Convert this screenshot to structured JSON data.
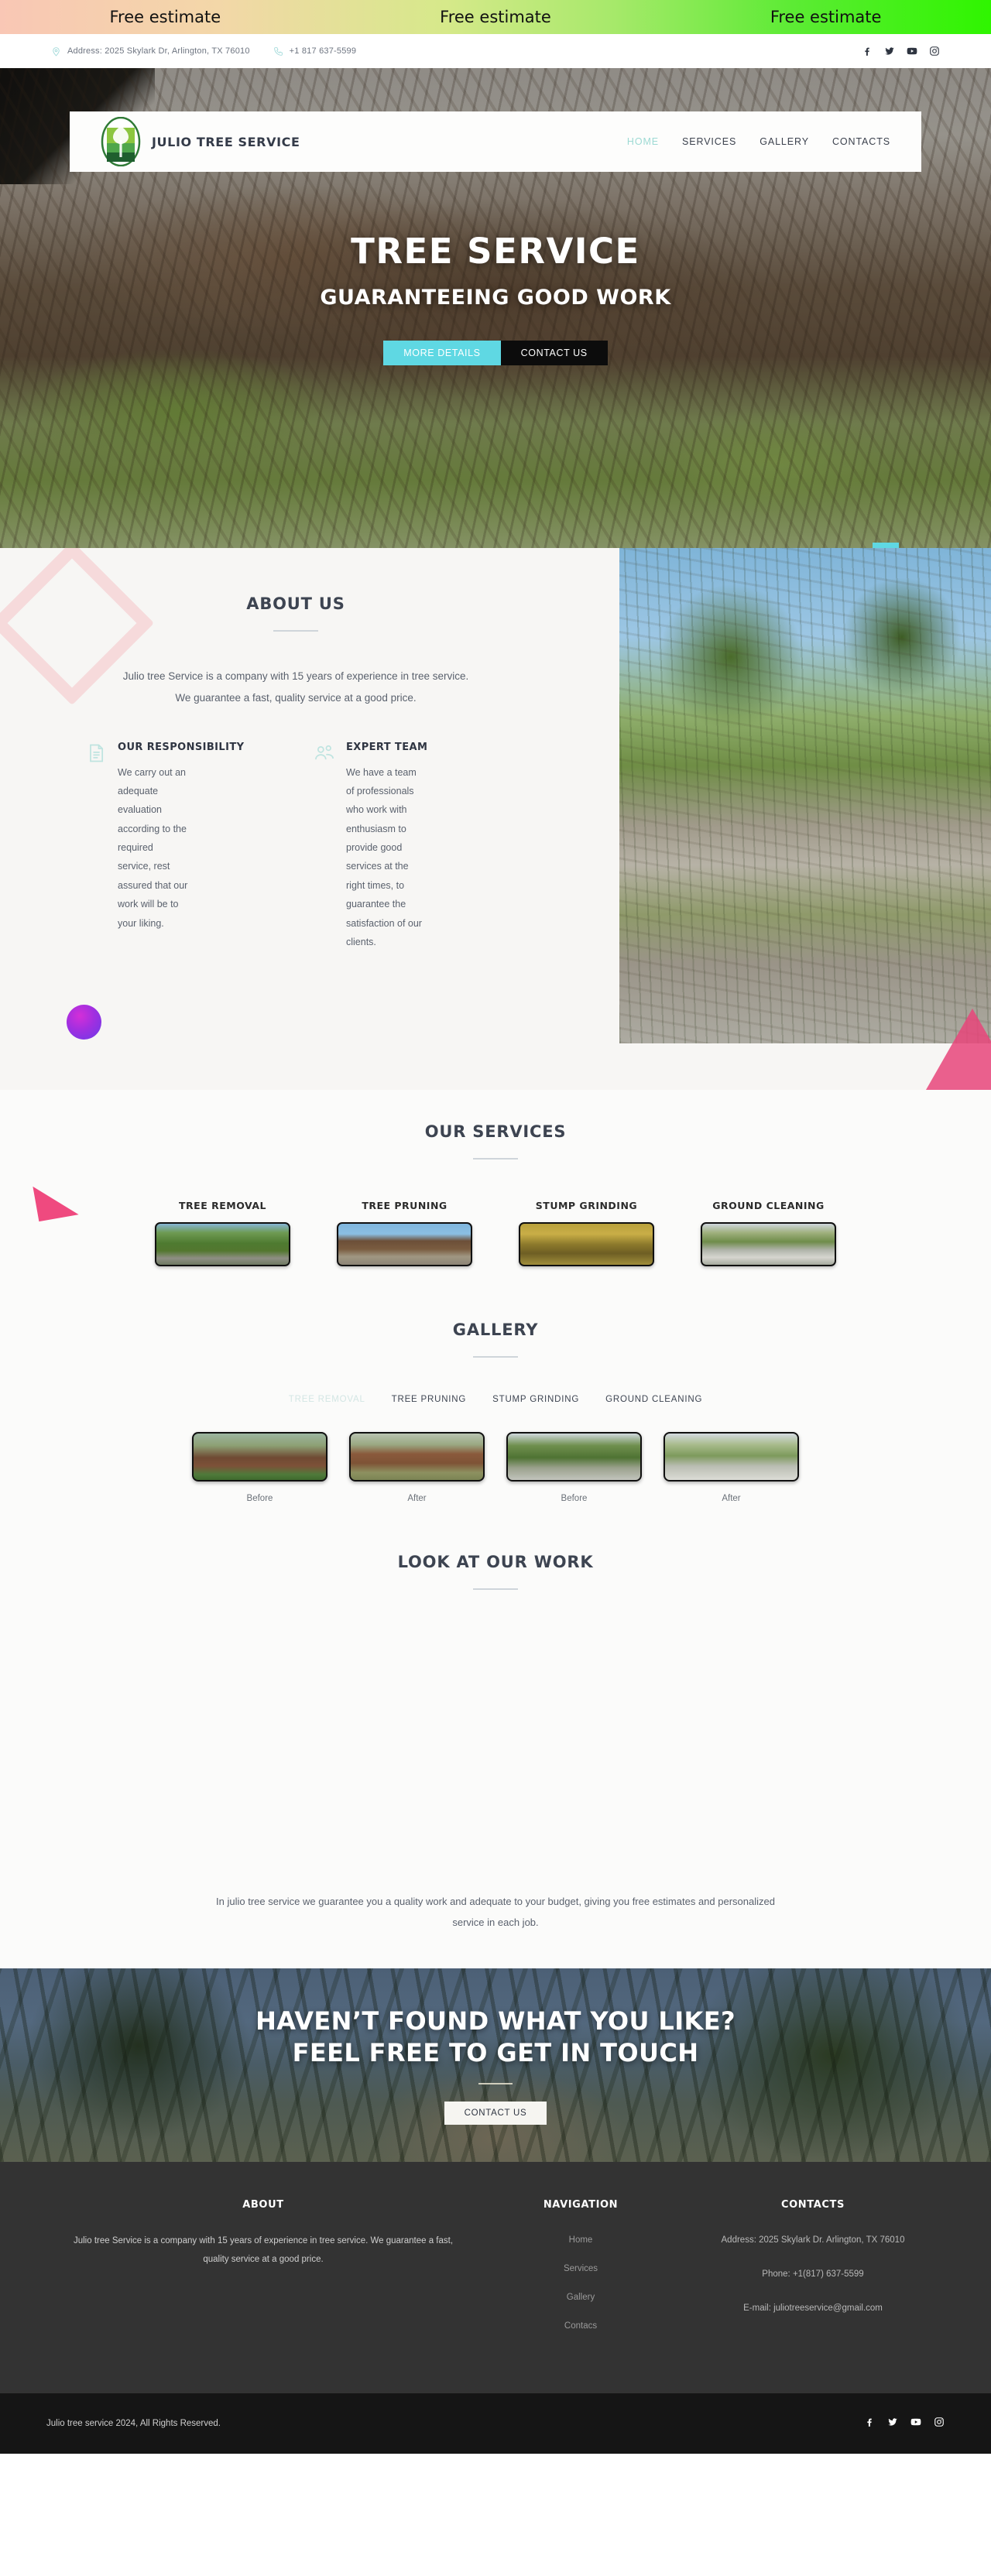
{
  "promo": {
    "items": [
      "Free estimate",
      "Free estimate",
      "Free estimate"
    ]
  },
  "topbar": {
    "address": "Address: 2025 Skylark Dr, Arlington, TX 76010",
    "phone": "+1 817 637-5599",
    "socials": [
      "facebook-icon",
      "twitter-icon",
      "youtube-icon",
      "instagram-icon"
    ]
  },
  "nav": {
    "brand": "JULIO TREE SERVICE",
    "links": [
      {
        "label": "HOME",
        "active": true
      },
      {
        "label": "SERVICES",
        "active": false
      },
      {
        "label": "GALLERY",
        "active": false
      },
      {
        "label": "CONTACTS",
        "active": false
      }
    ]
  },
  "hero": {
    "title": "TREE SERVICE",
    "subtitle": "GUARANTEEING GOOD WORK",
    "btn_primary": "MORE DETAILS",
    "btn_secondary": "CONTACT US",
    "accent_color": "#5fd8e3"
  },
  "about": {
    "title": "ABOUT US",
    "paragraph": "Julio tree Service is a company with 15 years of experience in tree service. We guarantee a fast, quality service at a good price.",
    "features": [
      {
        "icon": "document-icon",
        "title": "OUR RESPONSIBILITY",
        "text": "We carry out an adequate evaluation according to the required service, rest assured that our work will be to your liking."
      },
      {
        "icon": "team-icon",
        "title": "EXPERT TEAM",
        "text": "We have a team of professionals who work with enthusiasm to provide good services at the right times, to guarantee the satisfaction of our clients."
      }
    ]
  },
  "services": {
    "title": "OUR SERVICES",
    "items": [
      {
        "label": "TREE REMOVAL"
      },
      {
        "label": "TREE PRUNING"
      },
      {
        "label": "STUMP GRINDING"
      },
      {
        "label": "GROUND CLEANING"
      }
    ]
  },
  "gallery": {
    "title": "GALLERY",
    "tabs": [
      {
        "label": "TREE REMOVAL",
        "active": true
      },
      {
        "label": "TREE PRUNING",
        "active": false
      },
      {
        "label": "STUMP GRINDING",
        "active": false
      },
      {
        "label": "GROUND CLEANING",
        "active": false
      }
    ],
    "items": [
      {
        "caption": "Before"
      },
      {
        "caption": "After"
      },
      {
        "caption": "Before"
      },
      {
        "caption": "After"
      }
    ]
  },
  "work": {
    "title": "LOOK AT OUR WORK",
    "paragraph": "In julio tree service we guarantee you a quality work and adequate to your budget, giving you free estimates and personalized service in each job."
  },
  "cta": {
    "line1": "HAVEN’T FOUND WHAT YOU LIKE?",
    "line2": "FEEL FREE TO GET IN TOUCH",
    "button": "CONTACT US"
  },
  "footer": {
    "about_title": "ABOUT",
    "about_text": "Julio tree Service is a company with 15 years of experience in tree service. We guarantee a fast, quality service at a good price.",
    "nav_title": "NAVIGATION",
    "nav_items": [
      "Home",
      "Services",
      "Gallery",
      "Contacs"
    ],
    "contacts_title": "CONTACTS",
    "contact_address": "Address: 2025 Skylark Dr. Arlington, TX 76010",
    "contact_phone": "Phone: +1(817) 637-5599",
    "contact_email": "E-mail: juliotreeservice@gmail.com",
    "copyright": "Julio tree service 2024, All Rights Reserved.",
    "socials": [
      "facebook-icon",
      "twitter-icon",
      "youtube-icon",
      "instagram-icon"
    ]
  }
}
